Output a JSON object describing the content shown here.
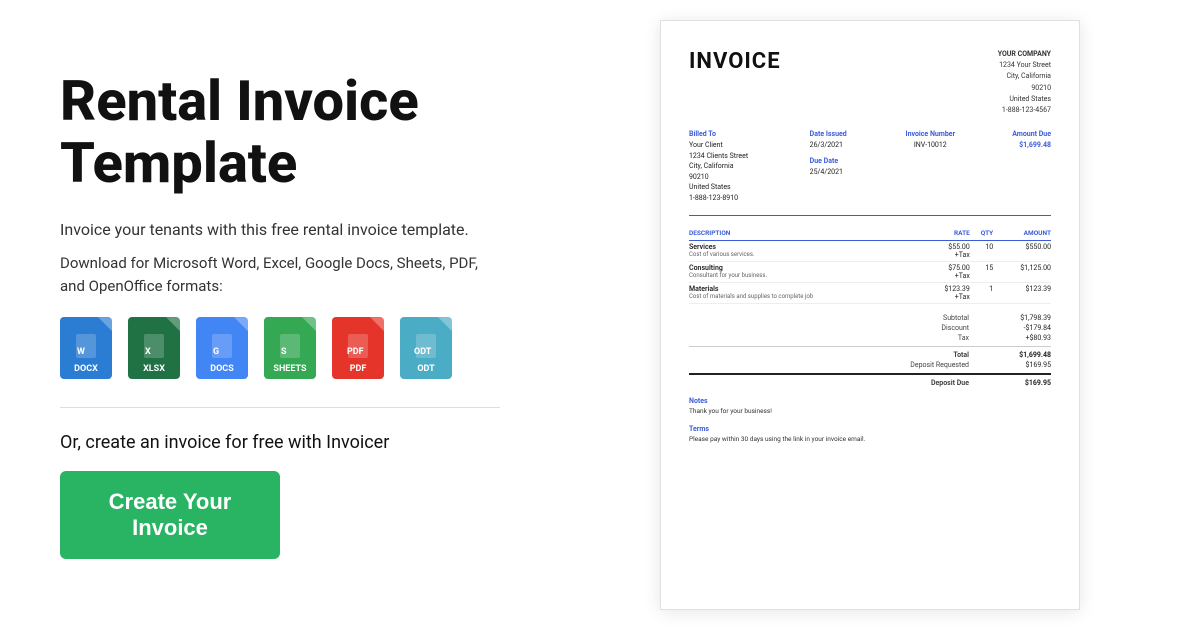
{
  "left": {
    "title": "Rental Invoice Template",
    "subtitle": "Invoice your tenants with this free rental invoice template.",
    "formats_text": "Download for Microsoft Word, Excel, Google Docs, Sheets, PDF, and OpenOffice formats:",
    "formats": [
      {
        "id": "docx",
        "label": "DOCX",
        "class": "docx"
      },
      {
        "id": "xlsx",
        "label": "XLSX",
        "class": "xlsx"
      },
      {
        "id": "gdocs",
        "label": "DOCS",
        "class": "gdocs"
      },
      {
        "id": "gsheets",
        "label": "SHEETS",
        "class": "gsheets"
      },
      {
        "id": "pdf",
        "label": "PDF",
        "class": "pdf"
      },
      {
        "id": "odt",
        "label": "ODT",
        "class": "odt"
      }
    ],
    "cta_text": "Or, create an invoice for free with Invoicer",
    "cta_button": "Create Your Invoice"
  },
  "invoice": {
    "title": "INVOICE",
    "company": {
      "name": "YOUR COMPANY",
      "address": "1234 Your Street",
      "city": "City, California",
      "zip": "90210",
      "country": "United States",
      "phone": "1-888-123-4567"
    },
    "billed_to": {
      "label": "Billed To",
      "client": "Your Client",
      "address": "1234 Clients Street",
      "city": "City, California",
      "zip": "90210",
      "country": "United States",
      "phone": "1-888-123-8910"
    },
    "date_issued": {
      "label": "Date Issued",
      "value": "26/3/2021"
    },
    "due_date": {
      "label": "Due Date",
      "value": "25/4/2021"
    },
    "invoice_number": {
      "label": "Invoice Number",
      "value": "INV-10012"
    },
    "amount_due": {
      "label": "Amount Due",
      "value": "$1,699.48"
    },
    "table": {
      "headers": [
        "DESCRIPTION",
        "RATE",
        "QTY",
        "AMOUNT"
      ],
      "items": [
        {
          "name": "Services",
          "desc": "Cost of various services.",
          "rate": "$55.00\n+Tax",
          "qty": "10",
          "amount": "$550.00"
        },
        {
          "name": "Consulting",
          "desc": "Consultant for your business.",
          "rate": "$75.00\n+Tax",
          "qty": "15",
          "amount": "$1,125.00"
        },
        {
          "name": "Materials",
          "desc": "Cost of materials and supplies to complete job",
          "rate": "$123.39\n+Tax",
          "qty": "1",
          "amount": "$123.39"
        }
      ]
    },
    "totals": {
      "subtotal_label": "Subtotal",
      "subtotal_value": "$1,798.39",
      "discount_label": "Discount",
      "discount_value": "-$179.84",
      "tax_label": "Tax",
      "tax_value": "+$80.93",
      "total_label": "Total",
      "total_value": "$1,699.48",
      "deposit_requested_label": "Deposit Requested",
      "deposit_requested_value": "$169.95",
      "deposit_due_label": "Deposit Due",
      "deposit_due_value": "$169.95"
    },
    "notes": {
      "label": "Notes",
      "text": "Thank you for your business!"
    },
    "terms": {
      "label": "Terms",
      "text": "Please pay within 30 days using the link in your invoice email."
    }
  }
}
